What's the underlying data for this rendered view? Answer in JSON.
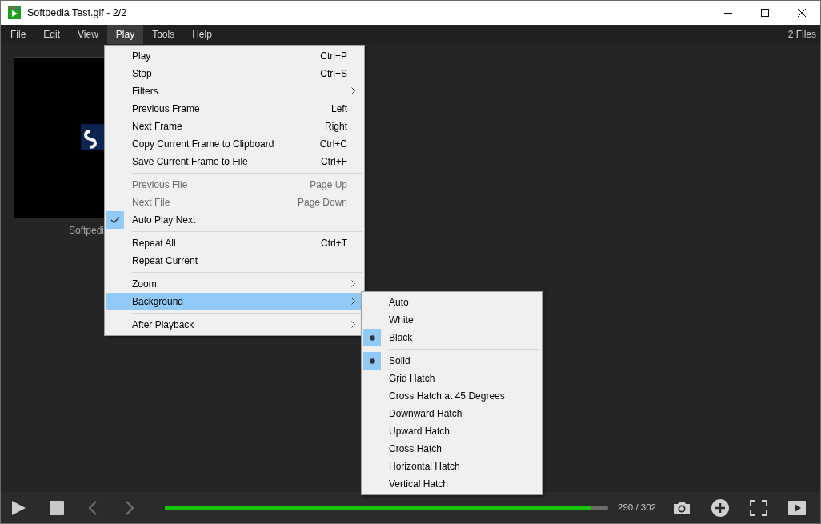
{
  "window": {
    "title": "Softpedia Test.gif - 2/2"
  },
  "menu_bar": [
    {
      "label": "File",
      "selected": false
    },
    {
      "label": "Edit",
      "selected": false
    },
    {
      "label": "View",
      "selected": false
    },
    {
      "label": "Play",
      "selected": true
    },
    {
      "label": "Tools",
      "selected": false
    },
    {
      "label": "Help",
      "selected": false
    }
  ],
  "file_count": "2 Files",
  "thumbnail": {
    "caption": "Softpedi"
  },
  "play_menu": [
    {
      "kind": "item",
      "label": "Play",
      "shortcut": "Ctrl+P",
      "submenu": false,
      "disabled": false,
      "checked": false,
      "selected": false
    },
    {
      "kind": "item",
      "label": "Stop",
      "shortcut": "Ctrl+S",
      "submenu": false,
      "disabled": false,
      "checked": false,
      "selected": false
    },
    {
      "kind": "item",
      "label": "Filters",
      "submenu": true,
      "disabled": false,
      "checked": false,
      "selected": false
    },
    {
      "kind": "item",
      "label": "Previous Frame",
      "shortcut": "Left",
      "submenu": false,
      "disabled": false,
      "checked": false,
      "selected": false
    },
    {
      "kind": "item",
      "label": "Next Frame",
      "shortcut": "Right",
      "submenu": false,
      "disabled": false,
      "checked": false,
      "selected": false
    },
    {
      "kind": "item",
      "label": "Copy Current Frame to Clipboard",
      "shortcut": "Ctrl+C",
      "submenu": false,
      "disabled": false,
      "checked": false,
      "selected": false
    },
    {
      "kind": "item",
      "label": "Save Current Frame to File",
      "shortcut": "Ctrl+F",
      "submenu": false,
      "disabled": false,
      "checked": false,
      "selected": false
    },
    {
      "kind": "separator"
    },
    {
      "kind": "item",
      "label": "Previous File",
      "shortcut": "Page Up",
      "submenu": false,
      "disabled": true,
      "checked": false,
      "selected": false
    },
    {
      "kind": "item",
      "label": "Next File",
      "shortcut": "Page Down",
      "submenu": false,
      "disabled": true,
      "checked": false,
      "selected": false
    },
    {
      "kind": "item",
      "label": "Auto Play Next",
      "submenu": false,
      "disabled": false,
      "checked": true,
      "selected": false
    },
    {
      "kind": "separator"
    },
    {
      "kind": "item",
      "label": "Repeat All",
      "shortcut": "Ctrl+T",
      "submenu": false,
      "disabled": false,
      "checked": false,
      "selected": false
    },
    {
      "kind": "item",
      "label": "Repeat Current",
      "submenu": false,
      "disabled": false,
      "checked": false,
      "selected": false
    },
    {
      "kind": "separator"
    },
    {
      "kind": "item",
      "label": "Zoom",
      "submenu": true,
      "disabled": false,
      "checked": false,
      "selected": false
    },
    {
      "kind": "item",
      "label": "Background",
      "submenu": true,
      "disabled": false,
      "checked": false,
      "selected": true
    },
    {
      "kind": "separator"
    },
    {
      "kind": "item",
      "label": "After Playback",
      "submenu": true,
      "disabled": false,
      "checked": false,
      "selected": false
    }
  ],
  "background_menu": [
    {
      "kind": "item",
      "label": "Auto",
      "checked": false
    },
    {
      "kind": "item",
      "label": "White",
      "checked": false
    },
    {
      "kind": "item",
      "label": "Black",
      "checked": true
    },
    {
      "kind": "separator"
    },
    {
      "kind": "item",
      "label": "Solid",
      "checked": true
    },
    {
      "kind": "item",
      "label": "Grid Hatch",
      "checked": false
    },
    {
      "kind": "item",
      "label": "Cross Hatch at 45 Degrees",
      "checked": false
    },
    {
      "kind": "item",
      "label": "Downward Hatch",
      "checked": false
    },
    {
      "kind": "item",
      "label": "Upward Hatch",
      "checked": false
    },
    {
      "kind": "item",
      "label": "Cross Hatch",
      "checked": false
    },
    {
      "kind": "item",
      "label": "Horizontal Hatch",
      "checked": false
    },
    {
      "kind": "item",
      "label": "Vertical Hatch",
      "checked": false
    }
  ],
  "player": {
    "level": 0.96,
    "position": "290 / 302"
  }
}
